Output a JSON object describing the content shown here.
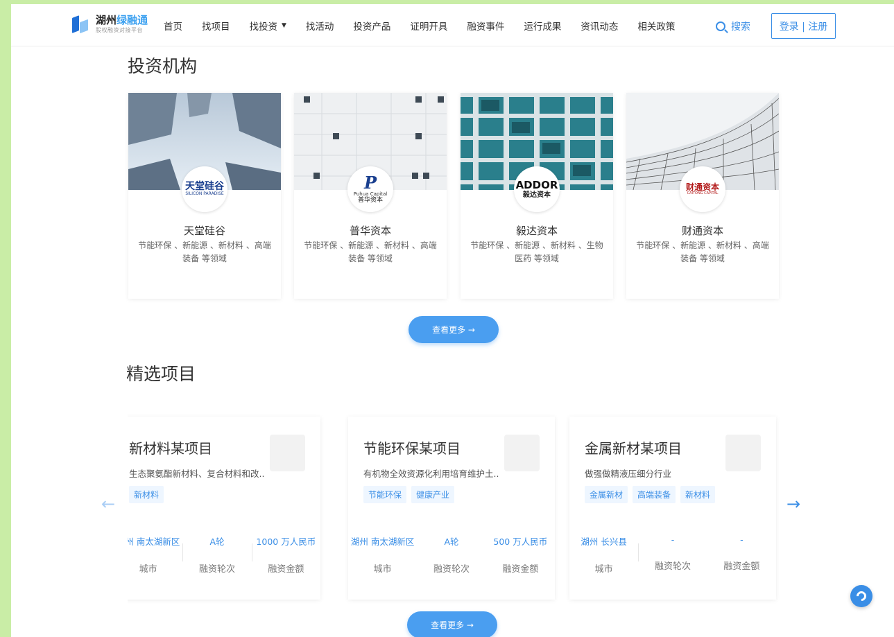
{
  "header": {
    "logo_title_main": "湖州",
    "logo_title_accent": "绿融通",
    "logo_subtitle": "股权融资对接平台",
    "nav": [
      "首页",
      "找项目",
      "找投资",
      "找活动",
      "投资产品",
      "证明开具",
      "融资事件",
      "运行成果",
      "资讯动态",
      "相关政策"
    ],
    "search_label": "搜索",
    "login_label": "登录 | 注册"
  },
  "investors": {
    "title": "投资机构",
    "items": [
      {
        "name": "天堂硅谷",
        "desc": "节能环保 、新能源 、新材料 、高端装备 等领域",
        "logo_text": "天堂硅谷",
        "logo_sub": "SILICON PARADISE"
      },
      {
        "name": "普华资本",
        "desc": "节能环保 、新能源 、新材料 、高端装备 等领域",
        "logo_text": "P",
        "logo_sub": "Puhua Capital",
        "logo_sub2": "普华资本"
      },
      {
        "name": "毅达资本",
        "desc": "节能环保 、新能源 、新材料 、生物医药 等领域",
        "logo_text": "ADDOR",
        "logo_sub": "毅达资本"
      },
      {
        "name": "财通资本",
        "desc": "节能环保 、新能源 、新材料 、高端装备 等领域",
        "logo_text": "财通资本",
        "logo_sub": "CAITONG CAPITAL"
      }
    ],
    "more_label": "查看更多 →"
  },
  "projects": {
    "title": "精选项目",
    "items": [
      {
        "title": "新材料某项目",
        "sub": "生态聚氨酯新材料、复合材料和改..",
        "tags": [
          "新材料"
        ],
        "city": "湖州 南太湖新区",
        "round": "A轮",
        "amount": "1000 万人民币"
      },
      {
        "title": "节能环保某项目",
        "sub": "有机物全效资源化利用培育维护土..",
        "tags": [
          "节能环保",
          "健康产业"
        ],
        "city": "湖州 南太湖新区",
        "round": "A轮",
        "amount": "500 万人民币"
      },
      {
        "title": "金属新材某项目",
        "sub": "做强做精液压细分行业",
        "tags": [
          "金属新材",
          "高端装备",
          "新材料"
        ],
        "city": "湖州 长兴县",
        "round": "-",
        "amount": "-"
      }
    ],
    "labels": {
      "city": "城市",
      "round": "融资轮次",
      "amount": "融资金额"
    },
    "more_label": "查看更多 →",
    "prev_arrow": "←",
    "next_arrow": "→"
  },
  "colors": {
    "accent": "#3a8ee6",
    "button": "#4a9ef0",
    "background": "#c9eda6"
  }
}
